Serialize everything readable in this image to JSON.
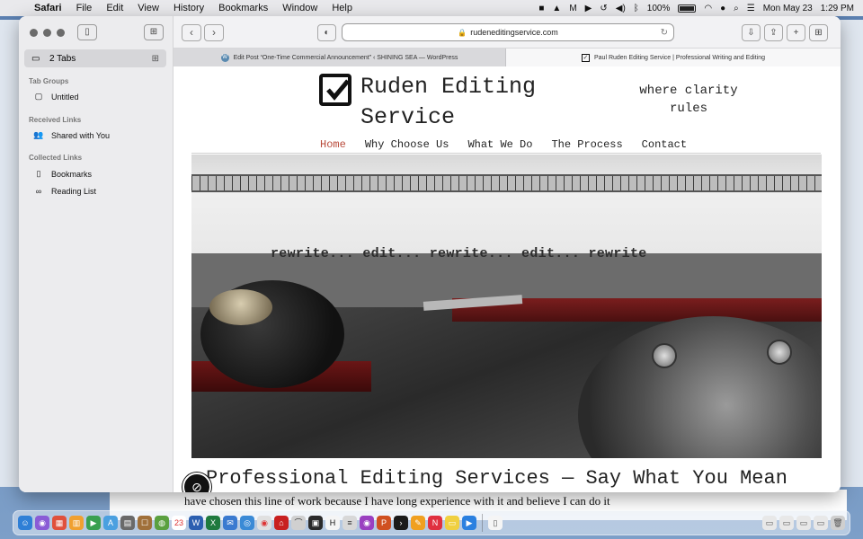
{
  "menubar": {
    "apple_glyph": "",
    "items": [
      "Safari",
      "File",
      "Edit",
      "View",
      "History",
      "Bookmarks",
      "Window",
      "Help"
    ],
    "battery": {
      "label": "100%",
      "level": 1.0
    },
    "date": "Mon May 23",
    "time": "1:29 PM"
  },
  "sidebar": {
    "tabs_label": "2 Tabs",
    "sections": {
      "tab_groups": "Tab Groups",
      "received_links": "Received Links",
      "collected_links": "Collected Links"
    },
    "items": {
      "untitled": "Untitled",
      "shared_with_you": "Shared with You",
      "bookmarks": "Bookmarks",
      "reading_list": "Reading List"
    }
  },
  "toolbar": {
    "url": "rudeneditingservice.com"
  },
  "tabs": [
    {
      "title": "Edit Post “One-Time Commercial Announcement” ‹ SHINING SEA — WordPress",
      "active": false
    },
    {
      "title": "Paul Ruden Editing Service | Professional Writing and Editing",
      "active": true
    }
  ],
  "site": {
    "title": "Ruden Editing Service",
    "tagline": "where clarity rules",
    "nav": [
      "Home",
      "Why Choose Us",
      "What We Do",
      "The Process",
      "Contact"
    ],
    "hero_typed_text": "rewrite... edit... rewrite... edit... rewrite",
    "headline": "Professional Editing Services — Say What You Mean"
  },
  "background_doc": {
    "text": "have chosen this line of work because I have long experience with it and believe I can do it"
  },
  "colors": {
    "nav_active": "#b94a3a",
    "menubar_bg": "#e9e9ec",
    "sidebar_bg": "#ececee"
  },
  "calendar_dock_day": "23"
}
